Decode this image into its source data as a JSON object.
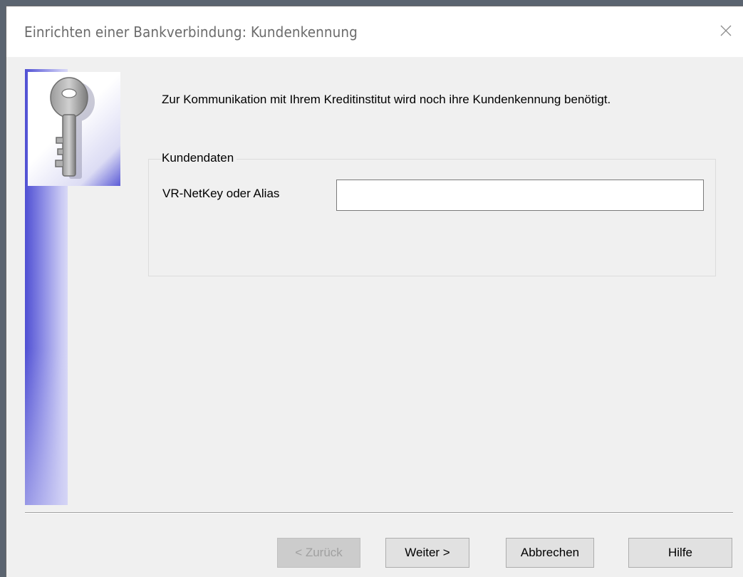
{
  "window": {
    "title": "Einrichten einer Bankverbindung: Kundenkennung",
    "close_icon": "close-icon"
  },
  "content": {
    "intro_text": "Zur Kommunikation mit Ihrem Kreditinstitut wird noch ihre Kundenkennung benötigt.",
    "key_icon": "key-icon",
    "group": {
      "legend": "Kundendaten",
      "field_label": "VR-NetKey oder Alias",
      "field_value": "",
      "field_placeholder": ""
    }
  },
  "buttons": {
    "back": "< Zurück",
    "next": "Weiter >",
    "cancel": "Abbrechen",
    "help": "Hilfe"
  },
  "colors": {
    "band_accent": "#4f4fd3",
    "window_bg": "#f0f0f0",
    "title_bg": "#ffffff"
  }
}
